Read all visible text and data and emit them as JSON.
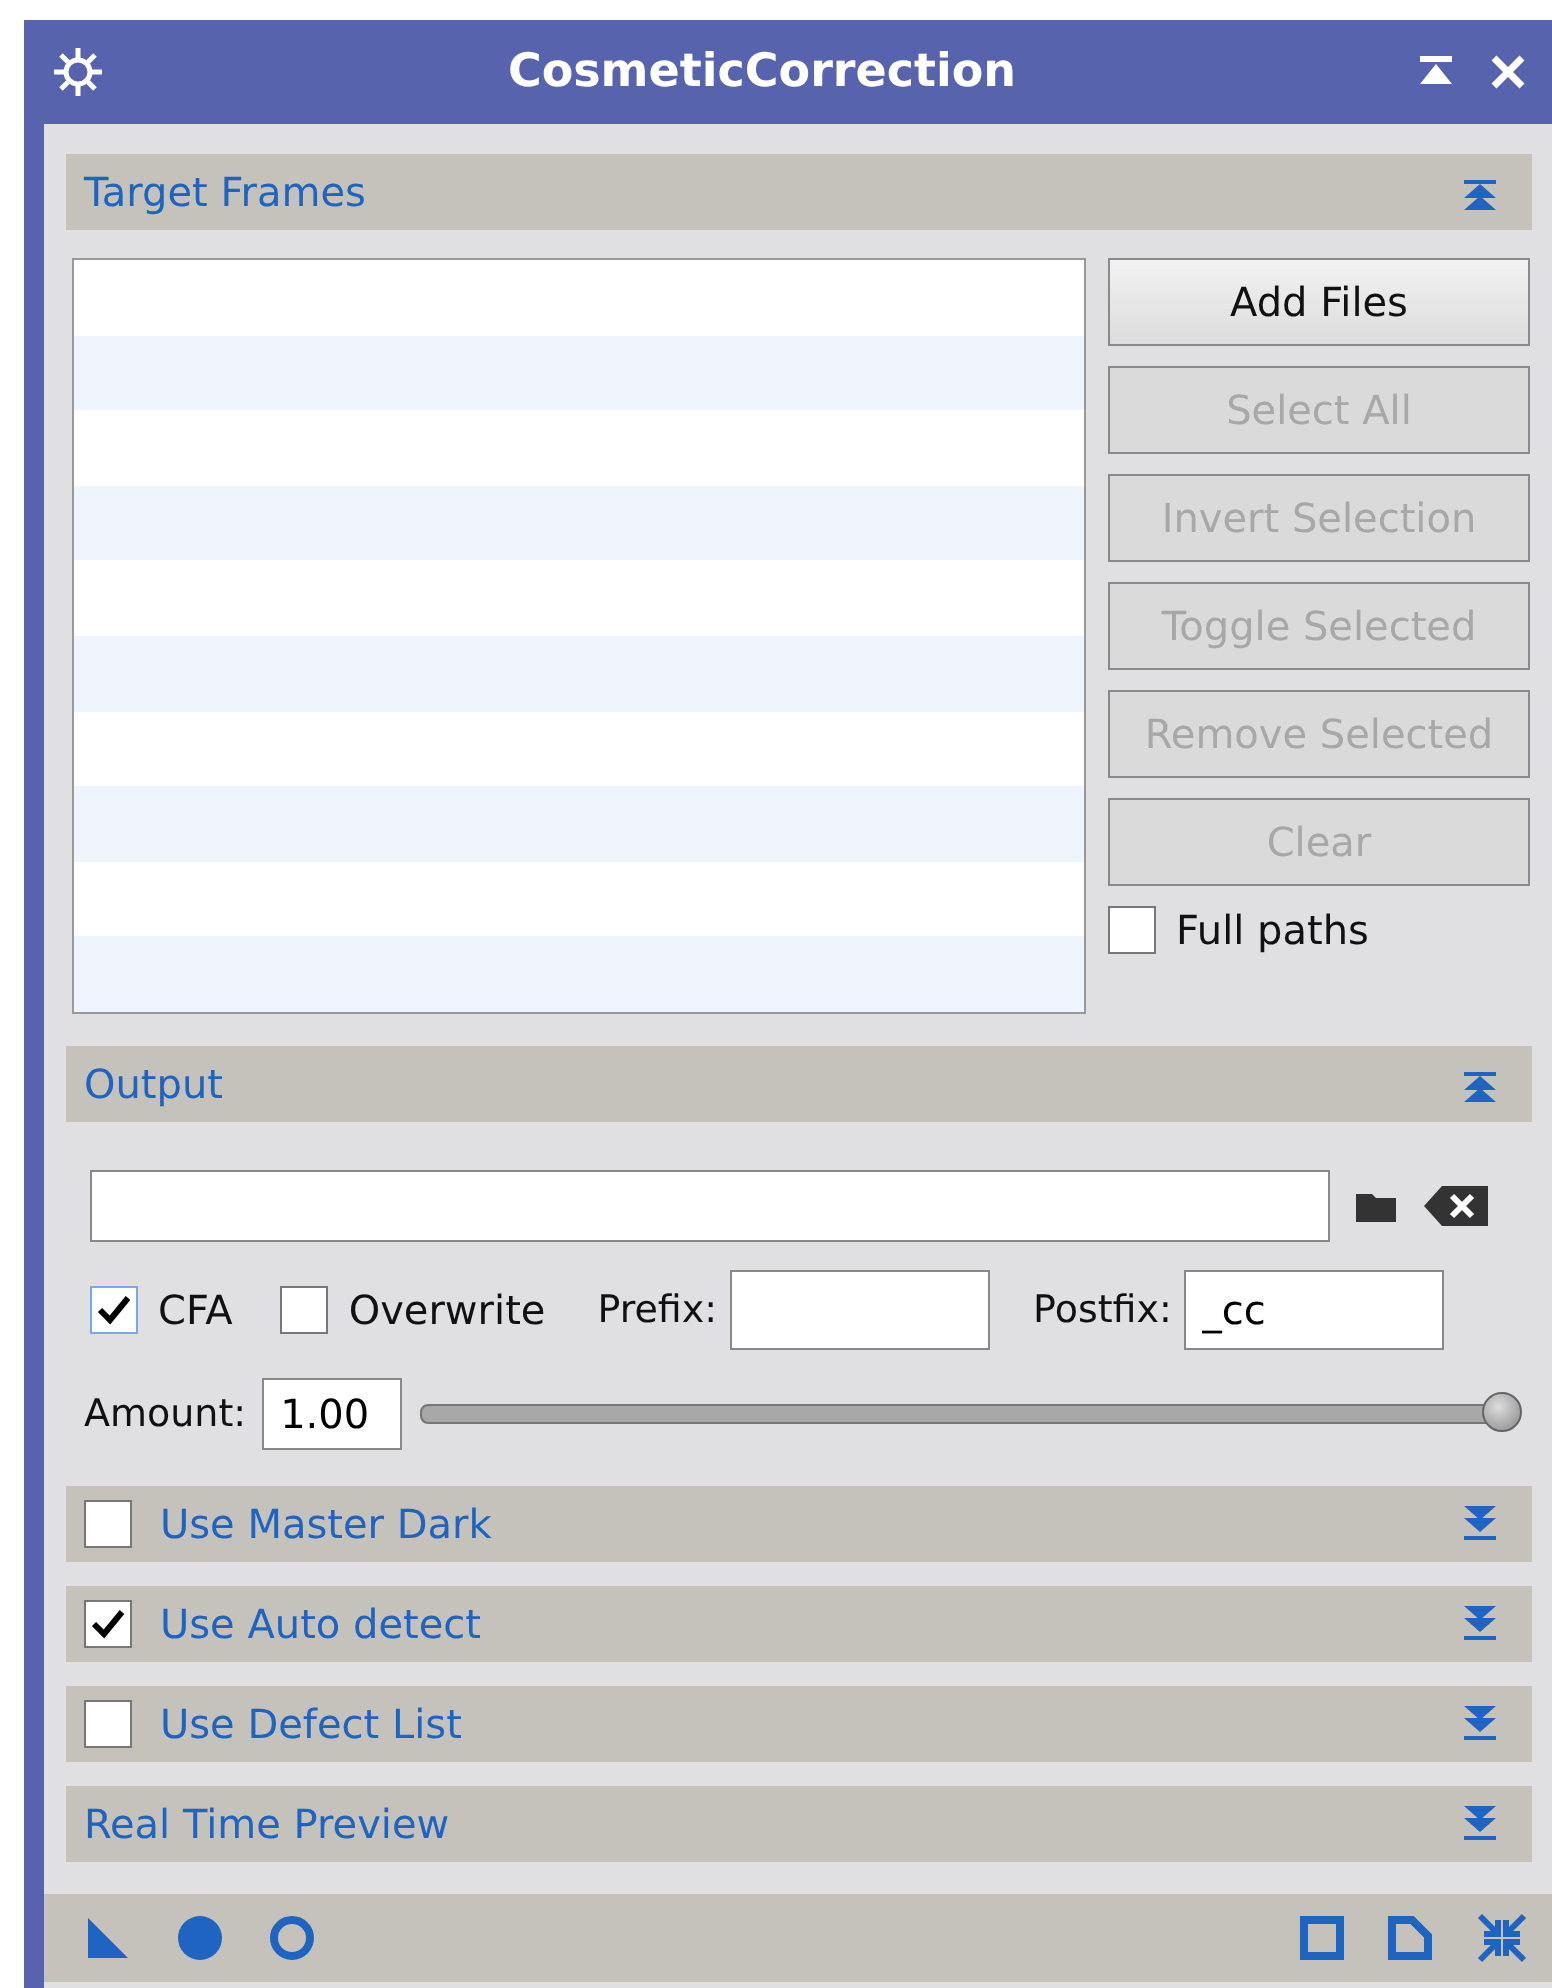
{
  "window": {
    "title": "CosmeticCorrection"
  },
  "target_frames": {
    "title": "Target Frames",
    "expanded": true,
    "buttons": [
      {
        "label": "Add Files",
        "disabled": false
      },
      {
        "label": "Select All",
        "disabled": true
      },
      {
        "label": "Invert Selection",
        "disabled": true
      },
      {
        "label": "Toggle Selected",
        "disabled": true
      },
      {
        "label": "Remove Selected",
        "disabled": true
      },
      {
        "label": "Clear",
        "disabled": true
      }
    ],
    "full_paths": {
      "label": "Full paths",
      "checked": false
    }
  },
  "output": {
    "title": "Output",
    "expanded": true,
    "cfa": {
      "label": "CFA",
      "checked": true
    },
    "overwrite": {
      "label": "Overwrite",
      "checked": false
    },
    "prefix": {
      "label": "Prefix:"
    },
    "postfix": {
      "label": "Postfix:",
      "value": "_cc"
    },
    "amount": {
      "label": "Amount:",
      "value": "1.00",
      "level": 1.0
    }
  },
  "sections": [
    {
      "kind": "checkable",
      "title": "Use Master Dark",
      "checked": false,
      "expanded": false
    },
    {
      "kind": "checkable",
      "title": "Use Auto detect",
      "checked": true,
      "expanded": false
    },
    {
      "kind": "checkable",
      "title": "Use Defect List",
      "checked": false,
      "expanded": false
    },
    {
      "kind": "plain",
      "title": "Real Time Preview",
      "expanded": false
    }
  ]
}
